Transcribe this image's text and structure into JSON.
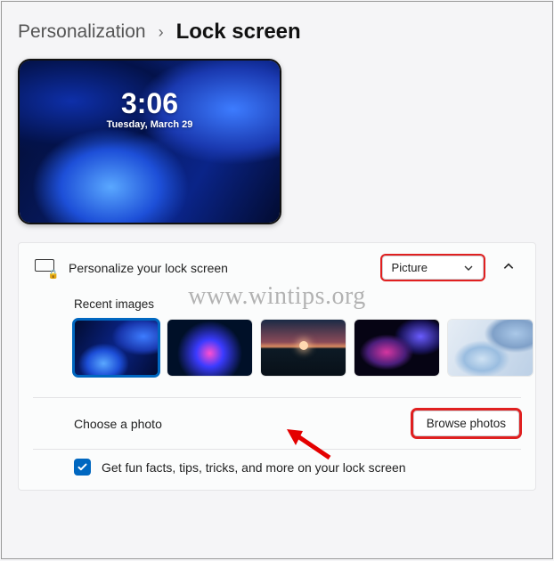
{
  "breadcrumb": {
    "previous": "Personalization",
    "separator": "›",
    "current": "Lock screen"
  },
  "preview": {
    "time": "3:06",
    "date": "Tuesday, March 29"
  },
  "panel": {
    "header_label": "Personalize your lock screen",
    "dropdown_value": "Picture",
    "sections": {
      "recent_title": "Recent images",
      "choose_label": "Choose a photo",
      "browse_button": "Browse photos",
      "fun_facts_label": "Get fun facts, tips, tricks, and more on your lock screen",
      "fun_facts_checked": true
    }
  },
  "watermark": "www.wintips.org"
}
